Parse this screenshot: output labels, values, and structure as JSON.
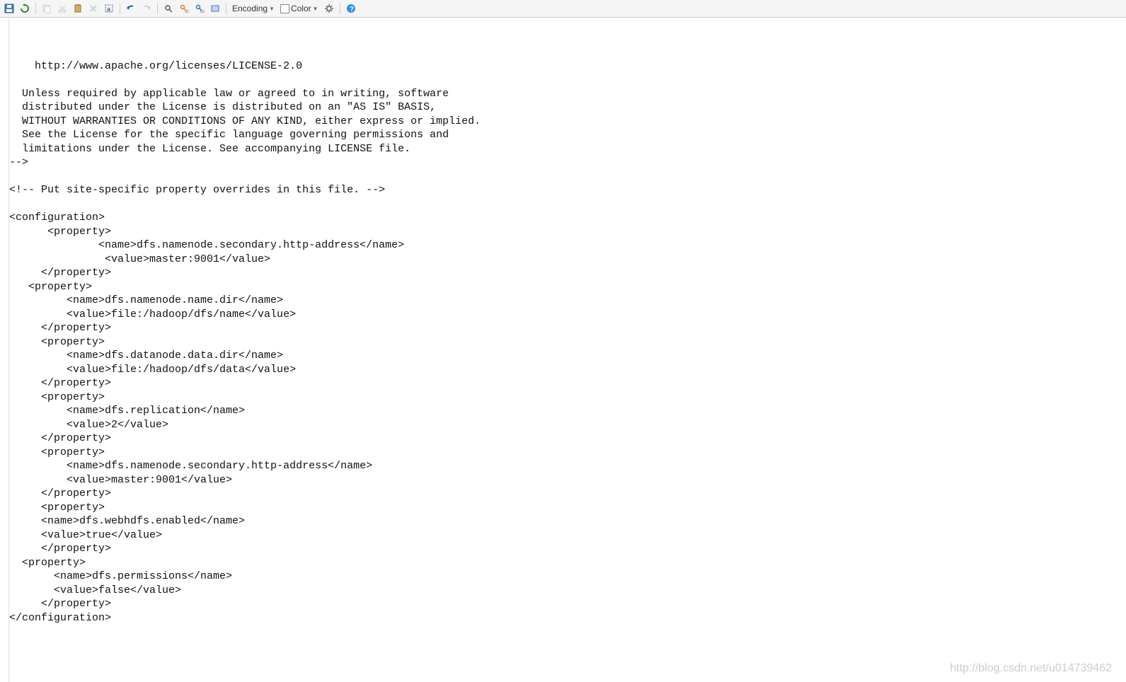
{
  "toolbar": {
    "encoding_label": "Encoding",
    "color_label": "Color"
  },
  "editor": {
    "lines": [
      "",
      "    http://www.apache.org/licenses/LICENSE-2.0",
      "",
      "  Unless required by applicable law or agreed to in writing, software",
      "  distributed under the License is distributed on an \"AS IS\" BASIS,",
      "  WITHOUT WARRANTIES OR CONDITIONS OF ANY KIND, either express or implied.",
      "  See the License for the specific language governing permissions and",
      "  limitations under the License. See accompanying LICENSE file.",
      "-->",
      "",
      "<!-- Put site-specific property overrides in this file. -->",
      "",
      "<configuration>",
      "      <property>",
      "              <name>dfs.namenode.secondary.http-address</name>",
      "               <value>master:9001</value>",
      "     </property>",
      "   <property>",
      "         <name>dfs.namenode.name.dir</name>",
      "         <value>file:/hadoop/dfs/name</value>",
      "     </property>",
      "     <property>",
      "         <name>dfs.datanode.data.dir</name>",
      "         <value>file:/hadoop/dfs/data</value>",
      "     </property>",
      "     <property>",
      "         <name>dfs.replication</name>",
      "         <value>2</value>",
      "     </property>",
      "     <property>",
      "         <name>dfs.namenode.secondary.http-address</name>",
      "         <value>master:9001</value>",
      "     </property>",
      "     <property>",
      "     <name>dfs.webhdfs.enabled</name>",
      "     <value>true</value>",
      "     </property>",
      "  <property>",
      "       <name>dfs.permissions</name>",
      "       <value>false</value>",
      "     </property>",
      "</configuration>"
    ]
  },
  "watermark": "http://blog.csdn.net/u014739462"
}
